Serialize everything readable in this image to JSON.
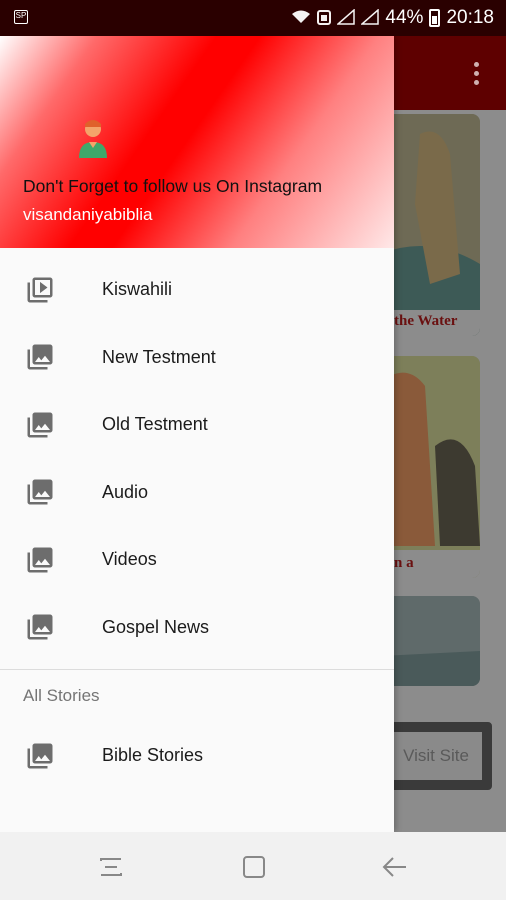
{
  "status_bar": {
    "battery": "44%",
    "time": "20:18"
  },
  "drawer": {
    "header": {
      "title": "Don't Forget to follow us On Instagram",
      "subtitle": "visandaniyabiblia"
    },
    "items": [
      {
        "label": "Kiswahili",
        "icon": "video-library-icon"
      },
      {
        "label": "New Testment",
        "icon": "photo-library-icon"
      },
      {
        "label": "Old Testment",
        "icon": "photo-library-icon"
      },
      {
        "label": "Audio",
        "icon": "photo-library-icon"
      },
      {
        "label": "Videos",
        "icon": "photo-library-icon"
      },
      {
        "label": "Gospel News",
        "icon": "photo-library-icon"
      }
    ],
    "section_title": "All Stories",
    "section_items": [
      {
        "label": "Bible Stories",
        "icon": "photo-library-icon"
      }
    ]
  },
  "background": {
    "card_captions": [
      "the Water",
      "n a"
    ],
    "visit_button": "Visit Site"
  },
  "colors": {
    "header_red": "#ff0000",
    "toolbar": "#8b0000"
  }
}
